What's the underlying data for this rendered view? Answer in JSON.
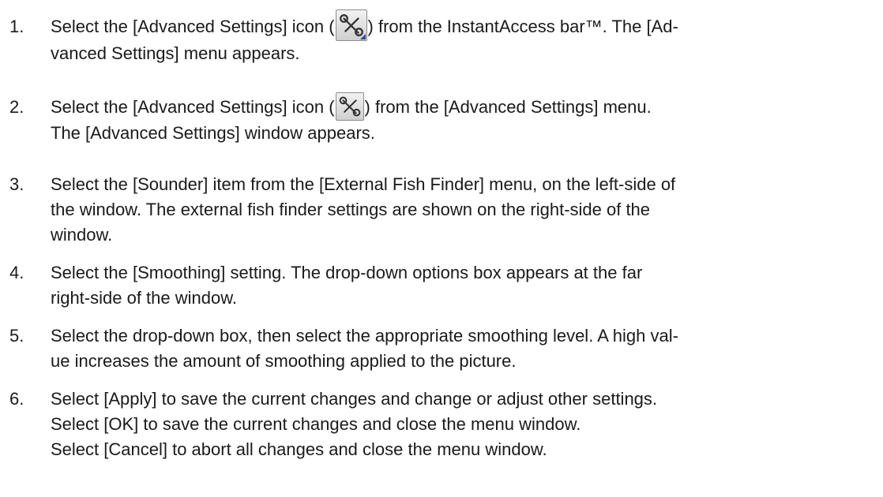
{
  "steps": [
    {
      "number": "1.",
      "pre": "Select the [Advanced Settings] icon (",
      "icon": "advanced-settings-icon",
      "post": ") from the InstantAccess bar™. The [Ad-",
      "line2": "vanced Settings] menu appears."
    },
    {
      "number": "2.",
      "pre": "Select the [Advanced Settings] icon (",
      "icon": "advanced-settings-icon",
      "post": ") from the [Advanced Settings] menu.",
      "line2": "The [Advanced Settings] window appears."
    },
    {
      "number": "3.",
      "line1": "Select the [Sounder] item from the [External Fish Finder] menu, on the left-side of",
      "line2": "the window. The external fish finder settings are shown on the right-side of the",
      "line3": "window."
    },
    {
      "number": "4.",
      "line1": "Select the [Smoothing] setting. The drop-down options box appears at the far",
      "line2": "right-side of the window."
    },
    {
      "number": "5.",
      "line1": "Select the drop-down box, then select the appropriate smoothing level. A high val-",
      "line2": "ue increases the amount of smoothing applied to the picture."
    },
    {
      "number": "6.",
      "line1": "Select [Apply] to save the current changes and change or adjust other settings.",
      "line2": "Select [OK] to save the current changes and close the menu window.",
      "line3": "Select [Cancel] to abort all changes and close the menu window."
    }
  ]
}
